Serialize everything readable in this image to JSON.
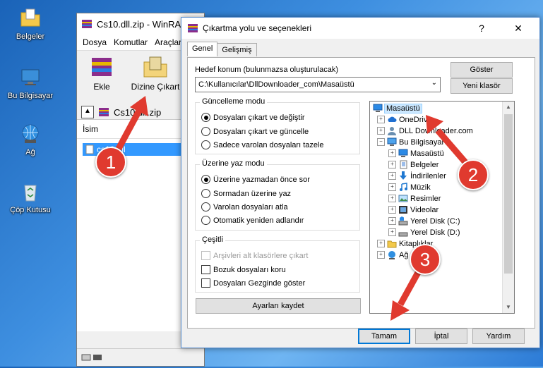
{
  "desktop": {
    "icons": [
      {
        "label": "Belgeler",
        "icon": "folder-icon"
      },
      {
        "label": "Bu Bilgisayar",
        "icon": "computer-icon"
      },
      {
        "label": "Ağ",
        "icon": "network-icon"
      },
      {
        "label": "Çöp Kutusu",
        "icon": "recycle-bin-icon"
      }
    ]
  },
  "winrar": {
    "title": "Cs10.dll.zip - WinRAR",
    "menu": [
      "Dosya",
      "Komutlar",
      "Araçlar"
    ],
    "toolbar": {
      "add_label": "Ekle",
      "extract_label": "Dizine Çıkart"
    },
    "path": "Cs10.dll.zip",
    "column_name": "İsim",
    "file": "cs10.dll"
  },
  "dialog": {
    "title": "Çıkartma yolu ve seçenekleri",
    "help_glyph": "?",
    "close_glyph": "✕",
    "tabs": [
      {
        "label": "Genel",
        "active": true
      },
      {
        "label": "Gelişmiş",
        "active": false
      }
    ],
    "dest_label": "Hedef konum (bulunmazsa oluşturulacak)",
    "dest_value": "C:\\Kullanıcılar\\DllDownloader_com\\Masaüstü",
    "show_button": "Göster",
    "new_folder_button": "Yeni klasör",
    "update_mode": {
      "title": "Güncelleme modu",
      "options": [
        {
          "label": "Dosyaları çıkart ve değiştir",
          "checked": true
        },
        {
          "label": "Dosyaları çıkart ve güncelle",
          "checked": false
        },
        {
          "label": "Sadece varolan dosyaları tazele",
          "checked": false
        }
      ]
    },
    "overwrite_mode": {
      "title": "Üzerine yaz modu",
      "options": [
        {
          "label": "Üzerine yazmadan önce sor",
          "checked": true
        },
        {
          "label": "Sormadan üzerine yaz",
          "checked": false
        },
        {
          "label": "Varolan dosyaları atla",
          "checked": false
        },
        {
          "label": "Otomatik yeniden adlandır",
          "checked": false
        }
      ]
    },
    "misc": {
      "title": "Çeşitli",
      "options": [
        {
          "label": "Arşivleri alt klasörlere çıkart",
          "checked": false,
          "disabled": true
        },
        {
          "label": "Bozuk dosyaları koru",
          "checked": false,
          "disabled": false
        },
        {
          "label": "Dosyaları Gezginde göster",
          "checked": false,
          "disabled": false
        }
      ]
    },
    "save_settings_button": "Ayarları kaydet",
    "tree": [
      {
        "label": "Masaüstü",
        "level": 0,
        "icon": "desktop-icon",
        "expand": "",
        "selected": true
      },
      {
        "label": "OneDrive",
        "level": 1,
        "icon": "cloud-icon",
        "expand": "+"
      },
      {
        "label": "DLL Downloader.com",
        "level": 1,
        "icon": "user-icon",
        "expand": "+"
      },
      {
        "label": "Bu Bilgisayar",
        "level": 1,
        "icon": "computer-icon",
        "expand": "−"
      },
      {
        "label": "Masaüstü",
        "level": 2,
        "icon": "desktop-icon",
        "expand": "+"
      },
      {
        "label": "Belgeler",
        "level": 2,
        "icon": "document-icon",
        "expand": "+"
      },
      {
        "label": "İndirilenler",
        "level": 2,
        "icon": "download-icon",
        "expand": "+"
      },
      {
        "label": "Müzik",
        "level": 2,
        "icon": "music-icon",
        "expand": "+"
      },
      {
        "label": "Resimler",
        "level": 2,
        "icon": "picture-icon",
        "expand": "+"
      },
      {
        "label": "Videolar",
        "level": 2,
        "icon": "video-icon",
        "expand": "+"
      },
      {
        "label": "Yerel Disk (C:)",
        "level": 2,
        "icon": "drive-icon",
        "expand": "+"
      },
      {
        "label": "Yerel Disk (D:)",
        "level": 2,
        "icon": "drive-icon",
        "expand": "+"
      },
      {
        "label": "Kitaplıklar",
        "level": 1,
        "icon": "library-icon",
        "expand": "+"
      },
      {
        "label": "Ağ",
        "level": 1,
        "icon": "network-icon",
        "expand": "+"
      }
    ],
    "ok_button": "Tamam",
    "cancel_button": "İptal",
    "help_button": "Yardım"
  },
  "callouts": [
    "1",
    "2",
    "3"
  ],
  "colors": {
    "callout": "#e03a2f",
    "selection": "#3399ff",
    "primary_border": "#0078d7"
  }
}
